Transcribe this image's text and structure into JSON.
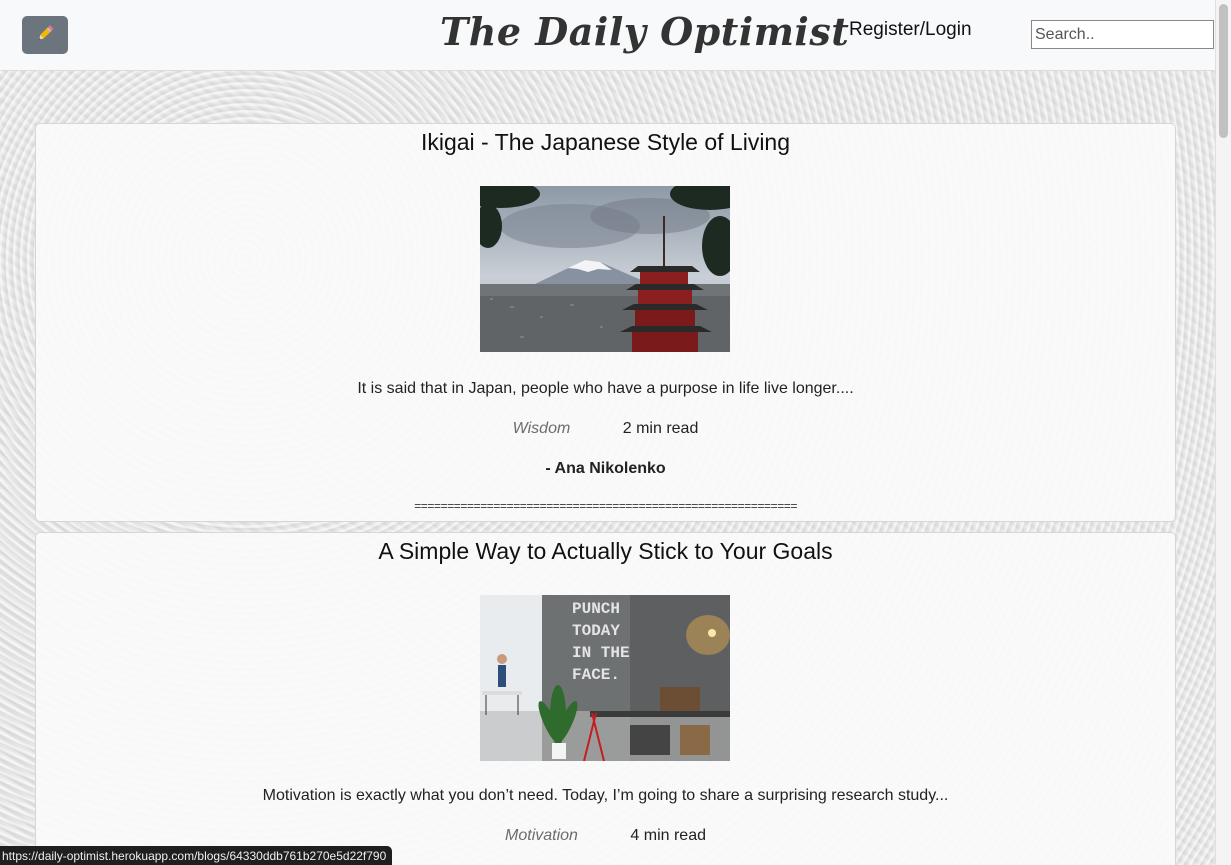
{
  "navbar": {
    "edit_icon": "pencil-icon",
    "brand": "The Daily Optimist",
    "login_label": "Register/Login",
    "search_placeholder": "Search.."
  },
  "posts": [
    {
      "title": "Ikigai - The Japanese Style of Living",
      "image": "mount-fuji-pagoda",
      "excerpt": "It is said that in Japan, people who have a purpose in life live longer....",
      "category": "Wisdom",
      "read_time": "2 min read",
      "author": "- Ana Nikolenko",
      "divider": "=========================================================="
    },
    {
      "title": "A Simple Way to Actually Stick to Your Goals",
      "image": "punch-today-in-the-face-office",
      "excerpt": "Motivation is exactly what you don’t need. Today, I’m going to share a surprising research study...",
      "category": "Motivation",
      "read_time": "4 min read",
      "image_text": "PUNCH TODAY IN THE FACE."
    }
  ],
  "status_bar": {
    "url": "https://daily-optimist.herokuapp.com/blogs/64330ddb761b270e5d22f790"
  }
}
